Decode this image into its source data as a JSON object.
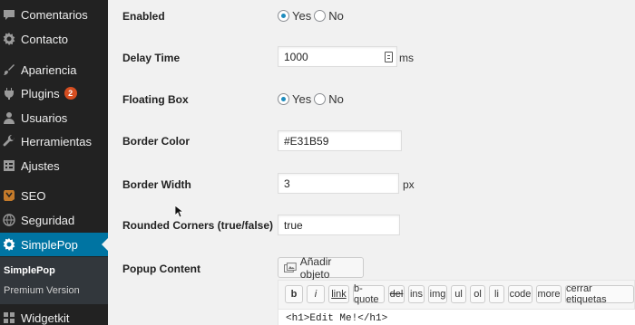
{
  "sidebar": {
    "items": [
      {
        "label": "Comentarios",
        "icon": "comment-icon"
      },
      {
        "label": "Contacto",
        "icon": "gear-icon"
      },
      {
        "label": "Apariencia",
        "icon": "brush-icon"
      },
      {
        "label": "Plugins",
        "icon": "plugin-icon",
        "badge": "2"
      },
      {
        "label": "Usuarios",
        "icon": "user-icon"
      },
      {
        "label": "Herramientas",
        "icon": "wrench-icon"
      },
      {
        "label": "Ajustes",
        "icon": "settings-icon"
      },
      {
        "label": "SEO",
        "icon": "seo-icon"
      },
      {
        "label": "Seguridad",
        "icon": "globe-icon"
      },
      {
        "label": "SimplePop",
        "icon": "gear-icon",
        "active": true
      },
      {
        "label": "Widgetkit",
        "icon": "widget-icon"
      }
    ],
    "submenu": [
      {
        "label": "SimplePop"
      },
      {
        "label": "Premium Version"
      }
    ]
  },
  "form": {
    "enabled": {
      "label": "Enabled",
      "yes": "Yes",
      "no": "No",
      "selected": "yes"
    },
    "delay": {
      "label": "Delay Time",
      "value": "1000",
      "unit": "ms"
    },
    "floating": {
      "label": "Floating Box",
      "yes": "Yes",
      "no": "No",
      "selected": "yes"
    },
    "border_color": {
      "label": "Border Color",
      "value": "#E31B59"
    },
    "border_width": {
      "label": "Border Width",
      "value": "3",
      "unit": "px"
    },
    "rounded": {
      "label": "Rounded Corners (true/false)",
      "value": "true"
    },
    "popup": {
      "label": "Popup Content",
      "media_button": "Añadir objeto",
      "quicktags": [
        "b",
        "i",
        "link",
        "b-quote",
        "del",
        "ins",
        "img",
        "ul",
        "ol",
        "li",
        "code",
        "more",
        "cerrar etiquetas"
      ],
      "content": "<h1>Edit Me!</h1>"
    }
  },
  "colors": {
    "sidebar_bg": "#222222",
    "active_bg": "#0074a2",
    "badge_bg": "#d54e21",
    "content_bg": "#f1f1f1"
  }
}
